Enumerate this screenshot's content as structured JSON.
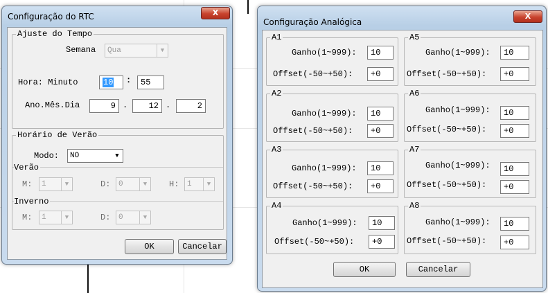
{
  "rtc_dialog": {
    "title": "Configuração do RTC",
    "close_symbol": "X",
    "time_group": {
      "legend": "Ajuste do Tempo",
      "week_label": "Semana",
      "week_value": "Qua",
      "time_label": "Hora: Minuto",
      "hour": "10",
      "time_sep": ":",
      "minute": "55",
      "date_label": "Ano.Mês.Dia",
      "year": "9",
      "month": "12",
      "day": "2",
      "date_sep": "."
    },
    "dst_group": {
      "legend": "Horário de Verão",
      "mode_label": "Modo:",
      "mode_value": "NO",
      "summer_legend": "Verão",
      "summer_m_label": "M:",
      "summer_m_value": "1",
      "summer_d_label": "D:",
      "summer_d_value": "0",
      "summer_h_label": "H:",
      "summer_h_value": "1",
      "winter_legend": "Inverno",
      "winter_m_label": "M:",
      "winter_m_value": "1",
      "winter_d_label": "D:",
      "winter_d_value": "0"
    },
    "ok_label": "OK",
    "cancel_label": "Cancelar"
  },
  "analog_dialog": {
    "title": "Configuração Analógica",
    "close_symbol": "X",
    "gain_label": "Ganho(1~999):",
    "offset_label": "Offset(-50~+50):",
    "channels": [
      {
        "name": "A1",
        "gain": "10",
        "offset": "+0"
      },
      {
        "name": "A2",
        "gain": "10",
        "offset": "+0"
      },
      {
        "name": "A3",
        "gain": "10",
        "offset": "+0"
      },
      {
        "name": "A4",
        "gain": "10",
        "offset": "+0"
      },
      {
        "name": "A5",
        "gain": "10",
        "offset": "+0"
      },
      {
        "name": "A6",
        "gain": "10",
        "offset": "+0"
      },
      {
        "name": "A7",
        "gain": "10",
        "offset": "+0"
      },
      {
        "name": "A8",
        "gain": "10",
        "offset": "+0"
      }
    ],
    "ok_label": "OK",
    "cancel_label": "Cancelar"
  },
  "icons": {
    "close": "close-icon",
    "dropdown": "chevron-down-icon"
  }
}
